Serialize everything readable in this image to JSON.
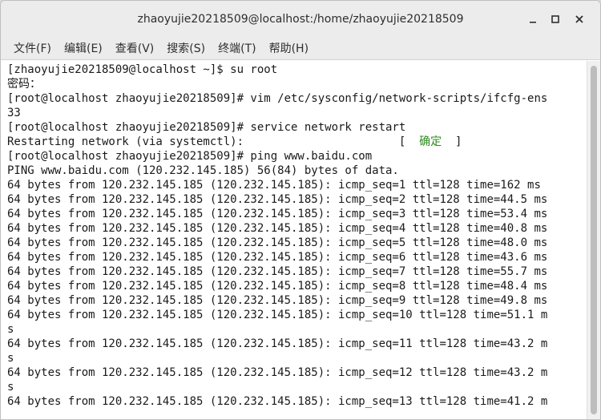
{
  "window": {
    "title": "zhaoyujie20218509@localhost:/home/zhaoyujie20218509",
    "buttons": {
      "minimize_icon": "minimize-icon",
      "maximize_icon": "maximize-icon",
      "close_icon": "close-icon"
    }
  },
  "menubar": {
    "items": [
      {
        "label": "文件(F)"
      },
      {
        "label": "编辑(E)"
      },
      {
        "label": "查看(V)"
      },
      {
        "label": "搜索(S)"
      },
      {
        "label": "终端(T)"
      },
      {
        "label": "帮助(H)"
      }
    ]
  },
  "terminal": {
    "lines": [
      "[zhaoyujie20218509@localhost ~]$ su root",
      "密码：",
      "[root@localhost zhaoyujie20218509]# vim /etc/sysconfig/network-scripts/ifcfg-ens",
      "33",
      "[root@localhost zhaoyujie20218509]# service network restart",
      {
        "pre": "Restarting network (via systemctl):                       [  ",
        "ok": "确定",
        "post": "  ]"
      },
      "[root@localhost zhaoyujie20218509]# ping www.baidu.com",
      "PING www.baidu.com (120.232.145.185) 56(84) bytes of data.",
      "64 bytes from 120.232.145.185 (120.232.145.185): icmp_seq=1 ttl=128 time=162 ms",
      "64 bytes from 120.232.145.185 (120.232.145.185): icmp_seq=2 ttl=128 time=44.5 ms",
      "64 bytes from 120.232.145.185 (120.232.145.185): icmp_seq=3 ttl=128 time=53.4 ms",
      "64 bytes from 120.232.145.185 (120.232.145.185): icmp_seq=4 ttl=128 time=40.8 ms",
      "64 bytes from 120.232.145.185 (120.232.145.185): icmp_seq=5 ttl=128 time=48.0 ms",
      "64 bytes from 120.232.145.185 (120.232.145.185): icmp_seq=6 ttl=128 time=43.6 ms",
      "64 bytes from 120.232.145.185 (120.232.145.185): icmp_seq=7 ttl=128 time=55.7 ms",
      "64 bytes from 120.232.145.185 (120.232.145.185): icmp_seq=8 ttl=128 time=48.4 ms",
      "64 bytes from 120.232.145.185 (120.232.145.185): icmp_seq=9 ttl=128 time=49.8 ms",
      "64 bytes from 120.232.145.185 (120.232.145.185): icmp_seq=10 ttl=128 time=51.1 m",
      "s",
      "64 bytes from 120.232.145.185 (120.232.145.185): icmp_seq=11 ttl=128 time=43.2 m",
      "s",
      "64 bytes from 120.232.145.185 (120.232.145.185): icmp_seq=12 ttl=128 time=43.2 m",
      "s",
      "64 bytes from 120.232.145.185 (120.232.145.185): icmp_seq=13 ttl=128 time=41.2 m"
    ]
  },
  "colors": {
    "ok_text": "#2e8b1f",
    "terminal_bg": "#ffffff",
    "terminal_fg": "#1a1a1a"
  }
}
